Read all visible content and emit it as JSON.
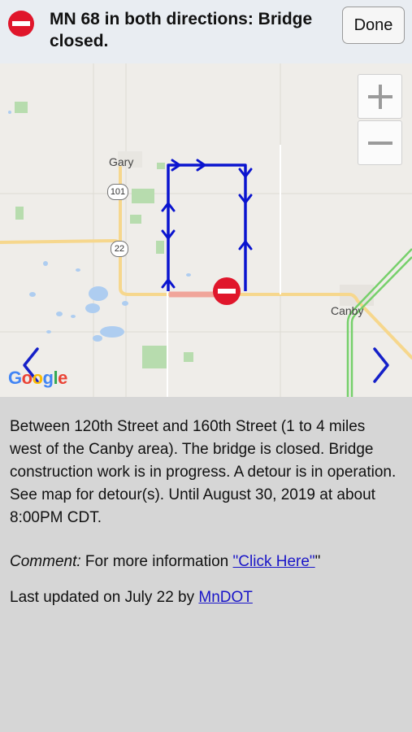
{
  "header": {
    "title": "MN 68 in both directions: Bridge closed.",
    "done_label": "Done",
    "icon": "no-entry-icon"
  },
  "map": {
    "places": {
      "gary": "Gary",
      "canby": "Canby"
    },
    "shields": {
      "r101": "101",
      "r22": "22"
    },
    "zoom_in_label": "+",
    "zoom_out_label": "−",
    "logo": {
      "l1": "G",
      "l2": "o",
      "l3": "o",
      "l4": "g",
      "l5": "l",
      "l6": "e"
    },
    "colors": {
      "detour": "#0a14cf",
      "closed_segment": "#f0a59a",
      "road": "#f6d78d",
      "highway": "#76d06b"
    }
  },
  "details": {
    "description": "Between 120th Street and 160th Street (1 to 4 miles west of the Canby area). The bridge is closed. Bridge construction work is in progress. A detour is in operation. See map for detour(s). Until August 30, 2019 at about 8:00PM CDT.",
    "comment_label": "Comment:",
    "comment_text": " For more information ",
    "comment_link": "\"Click Here\"",
    "comment_end": "\"",
    "updated_prefix": "Last updated on July 22 by ",
    "updated_link": "MnDOT"
  }
}
